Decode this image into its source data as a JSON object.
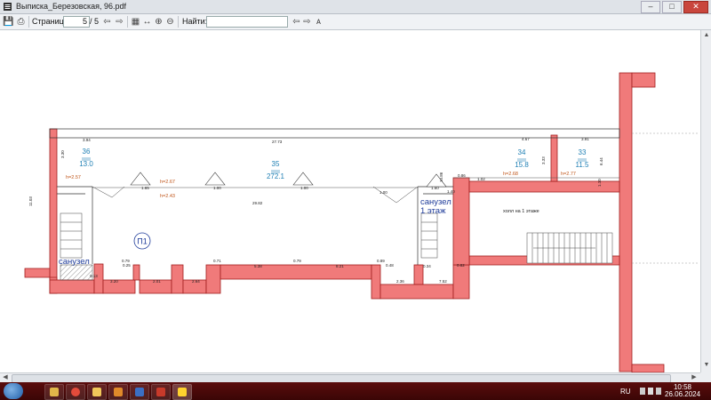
{
  "window": {
    "title": "Выписка_Березовская, 96.pdf"
  },
  "toolbar": {
    "page_label": "Страница:",
    "page_value": "5",
    "page_total": "/ 5",
    "find_label": "Найти:",
    "find_value": ""
  },
  "plan": {
    "rooms": [
      {
        "num": "36",
        "area": "13.0"
      },
      {
        "num": "35",
        "area": "272.1"
      },
      {
        "num": "34",
        "area": "15.8"
      },
      {
        "num": "33",
        "area": "11.5"
      }
    ],
    "heights": {
      "h1": "h=2.57",
      "h2": "h=2.67",
      "h3": "h=2.43",
      "h4": "h=2.68",
      "h5": "h=2.77"
    },
    "labels": {
      "sanuzel_left": "санузел",
      "sanuzel_right_1": "санузел",
      "sanuzel_right_2": "1 этаж",
      "hall": "холл на 1 этаже",
      "marker": "П1"
    },
    "dims": {
      "top_left": "3.94",
      "top_main": "27.73",
      "top_r1": "4.67",
      "top_r2": "3.91",
      "mid": "29.82",
      "left_side": "11.03",
      "bottom": [
        "3.20",
        "2.01",
        "2.64",
        "5.38",
        "8.21",
        "2.36",
        "7.52"
      ],
      "small": [
        "0.79",
        "0.71",
        "0.79",
        "0.89",
        "1.65",
        "1.00",
        "1.00",
        "1.00",
        "1.60",
        "3.33",
        "6.44",
        "1.02",
        "0.86",
        "1.40",
        "10.86",
        "1.10",
        "3.30",
        "0.25",
        "0.13",
        "0.48",
        "0.34",
        "0.82"
      ]
    }
  },
  "taskbar": {
    "lang": "RU",
    "time": "10:58",
    "date": "26.06.2024"
  },
  "colors": {
    "wall": "#f07a7a",
    "wall_stroke": "#a01e1e",
    "room_text": "#1e7fb4",
    "height_text": "#c0561a",
    "sanuzel_text": "#1f3c9a"
  }
}
